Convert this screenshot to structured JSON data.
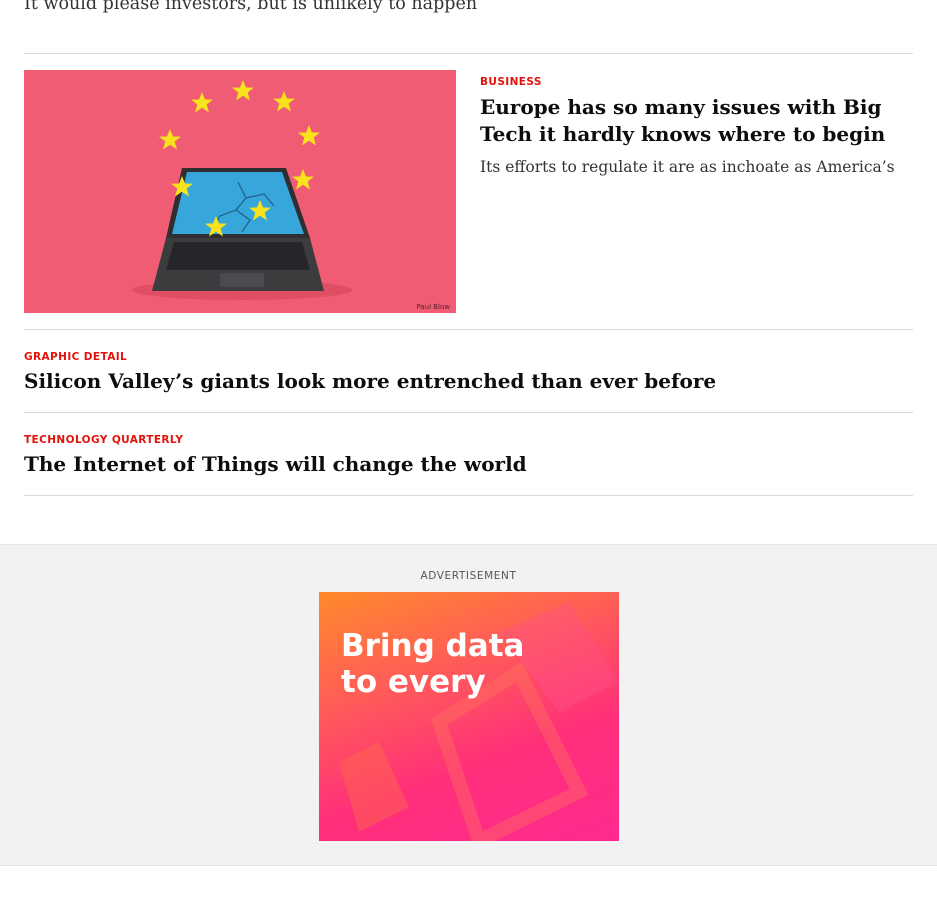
{
  "previous_article": {
    "standfirst": "It would please investors, but is unlikely to happen"
  },
  "feature": {
    "rubric": "Business",
    "headline": "Europe has so many issues with Big Tech it hardly knows where to begin",
    "standfirst": "Its efforts to regulate it are as inchoate as America’s",
    "image_credit": "Paul Blow",
    "image_icons": [
      "star-icon",
      "laptop-icon"
    ]
  },
  "articles": [
    {
      "rubric": "Graphic detail",
      "headline": "Silicon Valley’s giants look more entrenched than ever before"
    },
    {
      "rubric": "Technology Quarterly",
      "headline": "The Internet of Things will change the world"
    }
  ],
  "advertisement": {
    "label": "ADVERTISEMENT",
    "line1": "Bring data",
    "line2": "to every"
  },
  "colors": {
    "accent": "#e3120b",
    "image_bg": "#f05c73",
    "star": "#f7e21b",
    "screen": "#37a6da"
  }
}
